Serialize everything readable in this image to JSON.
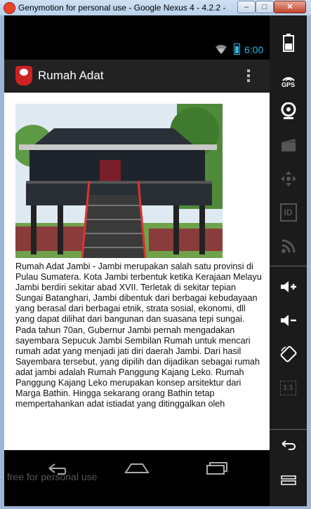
{
  "window": {
    "title": "Genymotion for personal use - Google Nexus 4 - 4.2.2 -",
    "minimize_label": "–",
    "maximize_label": "□",
    "close_label": "✕"
  },
  "status_bar": {
    "time": "6:00",
    "icons": [
      "wifi-icon",
      "battery-icon"
    ]
  },
  "action_bar": {
    "app_title": "Rumah Adat",
    "icons": [
      "app-logo-icon",
      "overflow-menu-icon"
    ]
  },
  "article": {
    "image": "rumah-adat-jambi-photo",
    "text": "Rumah Adat Jambi - Jambi merupakan salah satu provinsi di Pulau Sumatera. Kota Jambi terbentuk ketika Kerajaan Melayu Jambi berdiri sekitar abad XVII. Terletak di sekitar tepian Sungai Batanghari, Jambi dibentuk dari berbagai kebudayaan yang berasal dari berbagai etnik, strata sosial, ekonomi, dll yang dapat dilihat dari bangunan dan suasana tepi sungai.\nPada tahun 70an, Gubernur Jambi pernah mengadakan sayembara Sepucuk Jambi Sembilan Rumah untuk mencari rumah adat yang menjadi jati diri daerah Jambi. Dari hasil Sayembara tersebut, yang dipilih dan dijadikan sebagai rumah adat jambi adalah Rumah Panggung Kajang Leko.              Rumah Panggung Kajang Leko merupakan konsep arsitektur dari Marga Bathin. Hingga sekarang orang Bathin tetap mempertahankan adat istiadat yang ditinggalkan oleh"
  },
  "nav_bar": {
    "watermark": "free for personal use",
    "icons": [
      "back-icon",
      "home-icon",
      "recent-apps-icon"
    ]
  },
  "side_panel": {
    "gps_label": "GPS",
    "id_label": "ID",
    "scale_label": "1:1",
    "icons": [
      "battery-icon",
      "gps-icon",
      "webcam-icon",
      "video-icon",
      "dpad-icon",
      "id-icon",
      "rss-icon",
      "volume-up-icon",
      "volume-down-icon",
      "rotate-icon",
      "scale-icon",
      "back-icon",
      "menu-icon"
    ]
  }
}
